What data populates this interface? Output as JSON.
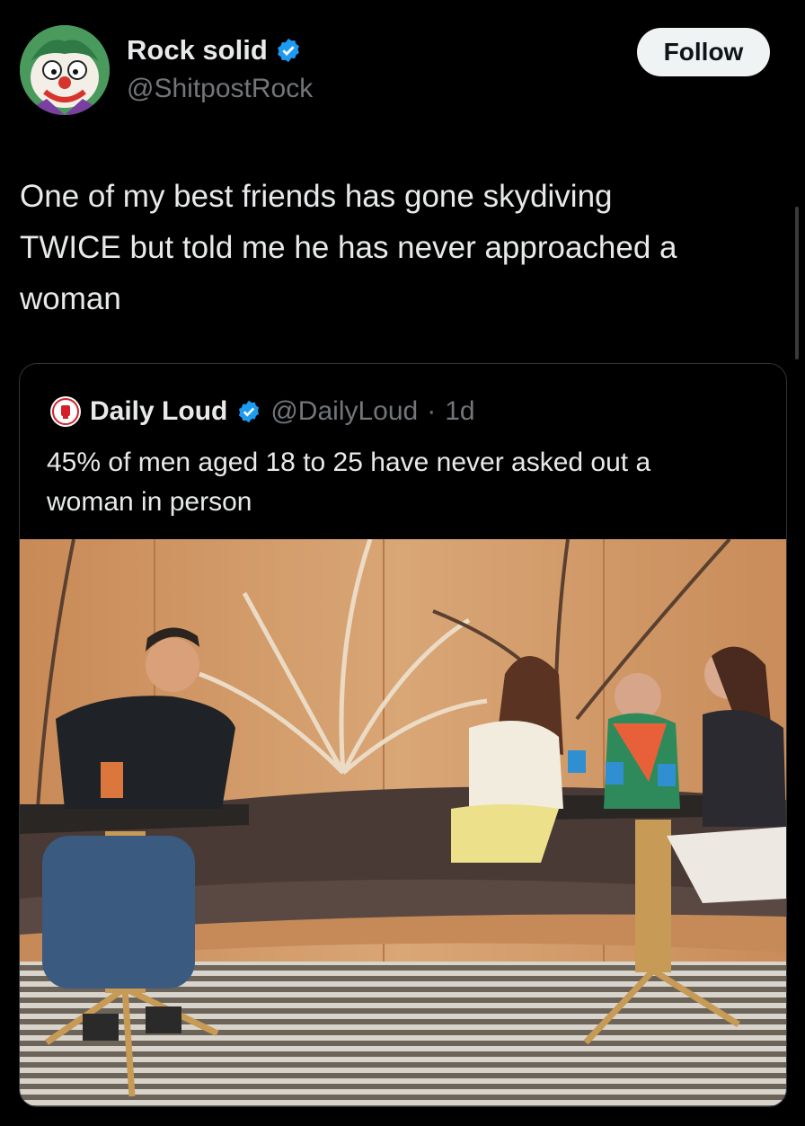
{
  "author": {
    "display_name": "Rock solid",
    "handle": "@ShitpostRock",
    "verified": true,
    "avatar_icon": "clown-avatar-icon"
  },
  "follow_label": "Follow",
  "tweet_lines": [
    "One of my best friends has gone skydiving",
    "TWICE but told me he has never approached a",
    "woman"
  ],
  "quote": {
    "display_name": "Daily Loud",
    "handle": "@DailyLoud",
    "separator": "·",
    "time": "1d",
    "verified": true,
    "text_lines": [
      "45% of men aged 18 to 25 have never asked out a",
      "woman in person"
    ]
  },
  "colors": {
    "background": "#000000",
    "text": "#e7e9ea",
    "secondary_text": "#71767b",
    "verified_blue": "#1d9bf0",
    "follow_bg": "#eff3f4"
  }
}
